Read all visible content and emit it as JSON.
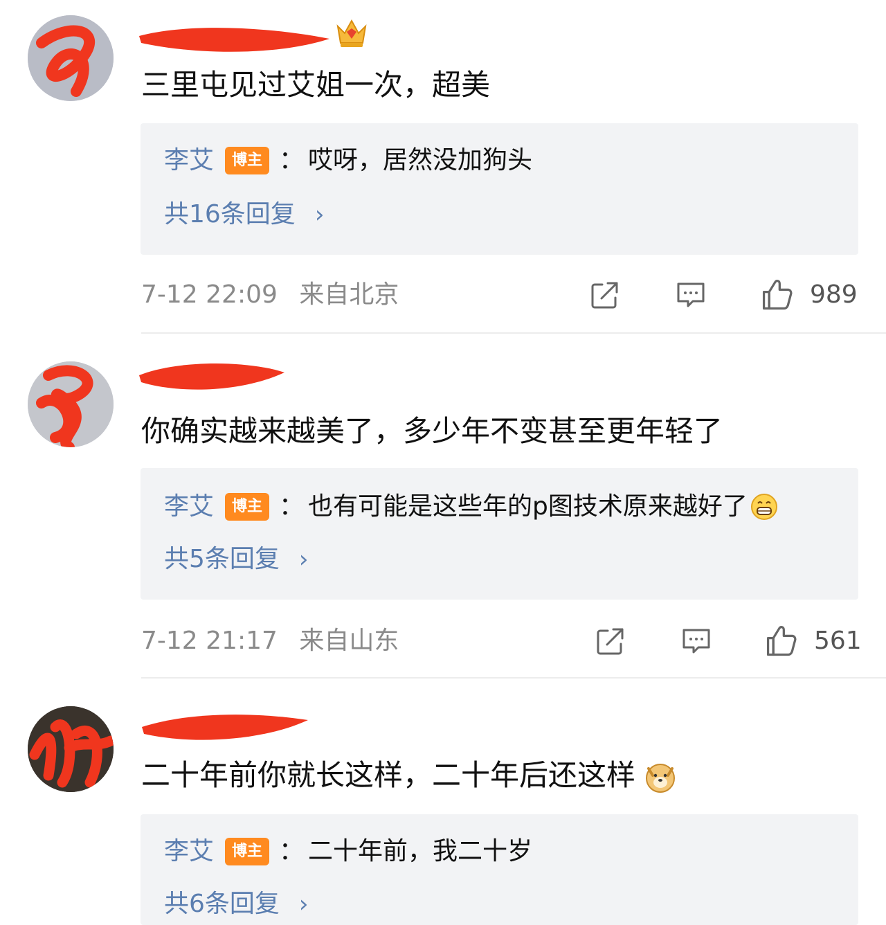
{
  "comments": [
    {
      "text": "三里屯见过艾姐一次，超美",
      "reply_author": "李艾",
      "blogger_badge": "博主",
      "reply_colon": "：",
      "reply_text": "哎呀，居然没加狗头",
      "reply_count": "共16条回复",
      "chevron": "›",
      "time": "7-12 22:09",
      "location": "来自北京",
      "likes": "989",
      "icons": [
        "share-icon",
        "comment-icon",
        "like-icon"
      ]
    },
    {
      "text": "你确实越来越美了，多少年不变甚至更年轻了",
      "reply_author": "李艾",
      "blogger_badge": "博主",
      "reply_colon": "：",
      "reply_text": "也有可能是这些年的p图技术原来越好了",
      "reply_count": "共5条回复",
      "chevron": "›",
      "time": "7-12 21:17",
      "location": "来自山东",
      "likes": "561",
      "icons": [
        "share-icon",
        "comment-icon",
        "like-icon"
      ]
    },
    {
      "text": "二十年前你就长这样，二十年后还这样",
      "reply_author": "李艾",
      "blogger_badge": "博主",
      "reply_colon": "：",
      "reply_text": "二十年前，我二十岁",
      "reply_count": "共6条回复",
      "chevron": "›"
    }
  ],
  "colors": {
    "link_blue": "#5b7eb0",
    "badge_orange": "#ff8a1f",
    "redact_red": "#f0361e",
    "reply_bg": "#f2f3f5"
  }
}
